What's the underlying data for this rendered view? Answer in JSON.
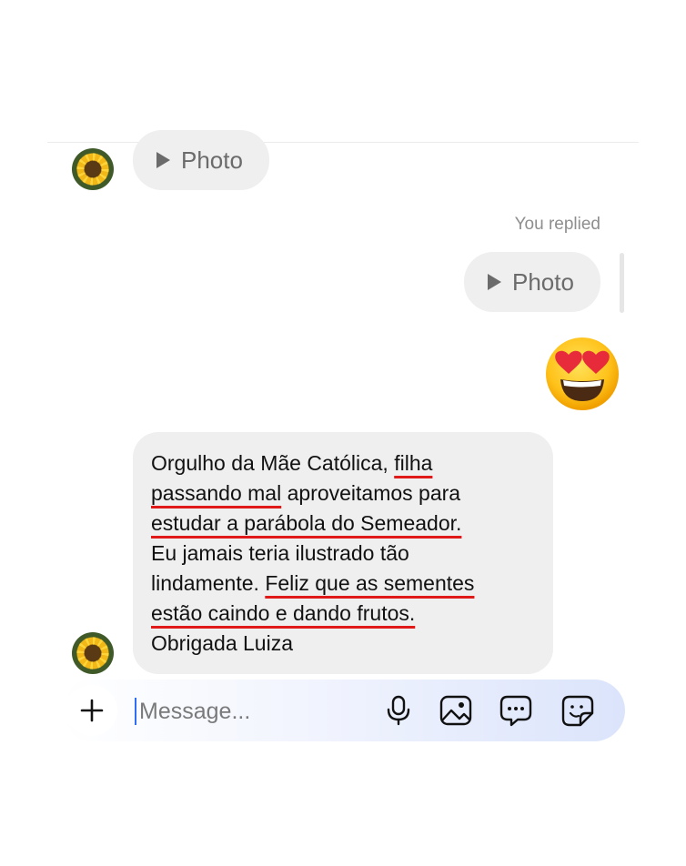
{
  "thread": {
    "incoming_media_label": "Photo",
    "replied_label": "You replied",
    "reply_media_label": "Photo",
    "reaction_emoji": "heart-eyes",
    "message_lines": [
      [
        {
          "text": "Orgulho da Mãe Católica, "
        },
        {
          "text": "filha",
          "u": true
        }
      ],
      [
        {
          "text": "passando mal",
          "u": true
        },
        {
          "text": " aproveitamos para"
        }
      ],
      [
        {
          "text": "estudar a parábola do Semeador.",
          "u": true
        }
      ],
      [
        {
          "text": "Eu jamais teria ilustrado tão"
        }
      ],
      [
        {
          "text": "lindamente. "
        },
        {
          "text": "Feliz que as sementes",
          "u": true
        }
      ],
      [
        {
          "text": "estão caindo e dando frutos.",
          "u": true
        }
      ],
      [
        {
          "text": "Obrigada Luiza"
        }
      ]
    ],
    "underline_color": "#e01919"
  },
  "composer": {
    "placeholder": "Message...",
    "value": ""
  },
  "icons": {
    "plus": "plus-icon",
    "mic": "microphone-icon",
    "gallery": "gallery-icon",
    "chat": "chat-bubble-icon",
    "sticker": "sticker-icon"
  },
  "colors": {
    "bubble": "#efefef",
    "caret": "#2f6df6"
  }
}
